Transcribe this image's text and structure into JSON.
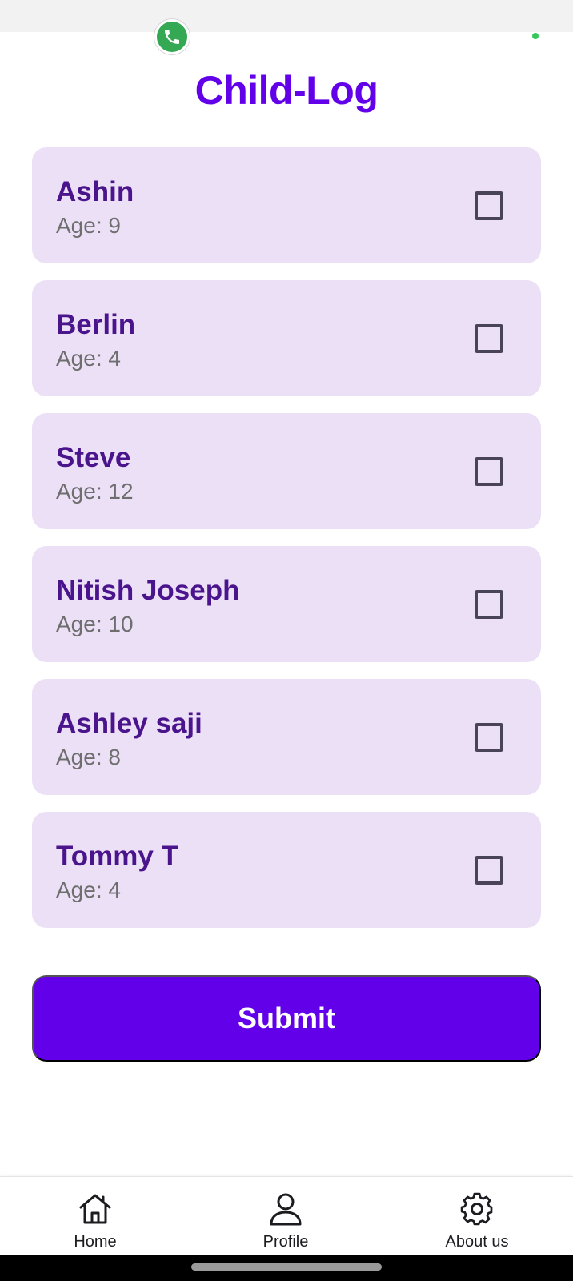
{
  "app": {
    "title": "Child-Log"
  },
  "children": [
    {
      "name": "Ashin",
      "age_label": "Age: 9",
      "checked": false
    },
    {
      "name": "Berlin",
      "age_label": "Age: 4",
      "checked": false
    },
    {
      "name": "Steve",
      "age_label": "Age: 12",
      "checked": false
    },
    {
      "name": "Nitish Joseph",
      "age_label": "Age: 10",
      "checked": false
    },
    {
      "name": "Ashley saji",
      "age_label": "Age: 8",
      "checked": false
    },
    {
      "name": "Tommy T",
      "age_label": "Age: 4",
      "checked": false
    }
  ],
  "actions": {
    "submit_label": "Submit"
  },
  "bottom_nav": {
    "items": [
      {
        "label": "Home",
        "icon": "home-icon"
      },
      {
        "label": "Profile",
        "icon": "person-icon"
      },
      {
        "label": "About us",
        "icon": "gear-icon"
      }
    ]
  },
  "colors": {
    "accent": "#6200ea",
    "card_background": "#ece0f7",
    "name_text": "#4a148c",
    "call_bubble": "#34a853"
  }
}
